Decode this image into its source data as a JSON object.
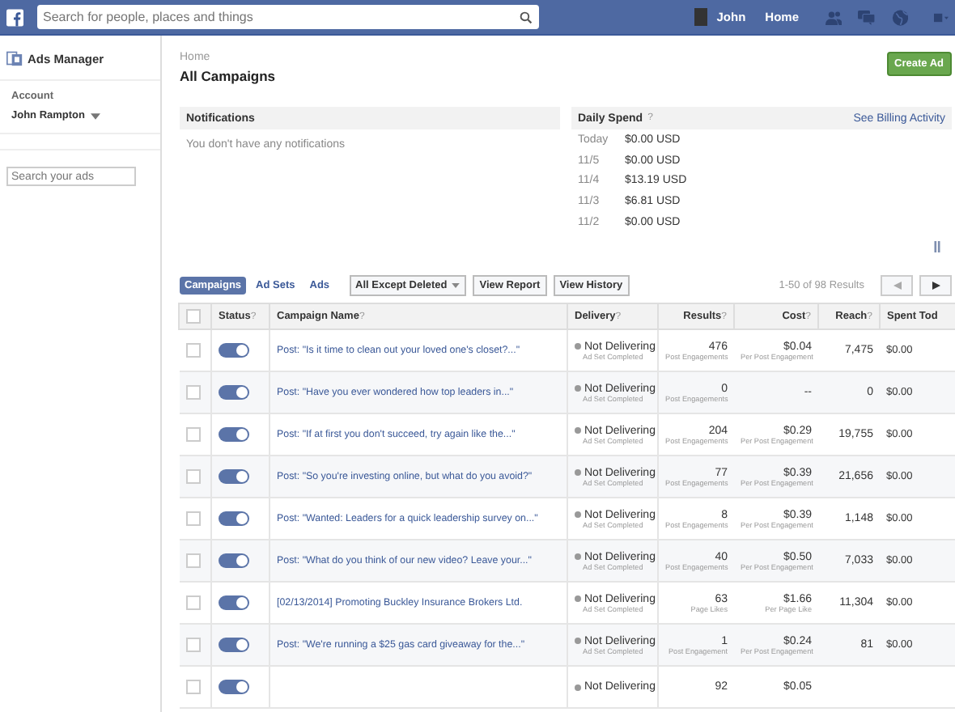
{
  "topbar": {
    "search_placeholder": "Search for people, places and things",
    "user_name": "John",
    "home_link": "Home"
  },
  "sidebar": {
    "title": "Ads Manager",
    "account_label": "Account",
    "account_name": "John Rampton",
    "search_placeholder": "Search your ads"
  },
  "breadcrumb": "Home",
  "page_title": "All Campaigns",
  "create_button": "Create Ad",
  "notifications": {
    "title": "Notifications",
    "message": "You don't have any notifications"
  },
  "daily_spend": {
    "title": "Daily Spend",
    "help": "?",
    "link": "See Billing Activity",
    "entries": [
      {
        "date": "Today",
        "amount": "$0.00 USD"
      },
      {
        "date": "11/5",
        "amount": "$0.00 USD"
      },
      {
        "date": "11/4",
        "amount": "$13.19 USD"
      },
      {
        "date": "11/3",
        "amount": "$6.81 USD"
      },
      {
        "date": "11/2",
        "amount": "$0.00 USD"
      }
    ]
  },
  "view_tabs": [
    {
      "label": "Campaigns",
      "selected": true
    },
    {
      "label": "Ad Sets",
      "selected": false
    },
    {
      "label": "Ads",
      "selected": false
    }
  ],
  "filter": "All Except Deleted",
  "buttons": [
    "View Report",
    "View History"
  ],
  "pagination": "1-50 of 98 Results",
  "table": {
    "select_all": {
      "checked": false
    },
    "columns": [
      {
        "label": "Status",
        "help": "?"
      },
      {
        "label": "Campaign Name",
        "help": "?"
      },
      {
        "label": "Delivery",
        "help": "?"
      },
      {
        "label": "Results",
        "help": "?"
      },
      {
        "label": "Cost",
        "help": "?"
      },
      {
        "label": "Reach",
        "help": "?"
      },
      {
        "label": "Spent Tod"
      }
    ],
    "rows": [
      {
        "checked": false,
        "on": true,
        "name": "Post: \"Is it time to clean out your loved one's closet?...\"",
        "delivery": "Not Delivering",
        "delivery_note": "Ad Set Completed",
        "results": "476",
        "results_unit": "Post Engagements",
        "cost": "$0.04",
        "cost_unit": "Per Post Engagement",
        "reach": "7,475",
        "spent": "$0.00"
      },
      {
        "checked": false,
        "on": true,
        "name": "Post: \"Have you ever wondered how top leaders in...\"",
        "delivery": "Not Delivering",
        "delivery_note": "Ad Set Completed",
        "results": "0",
        "results_unit": "Post Engagements",
        "cost": "--",
        "reach": "0",
        "spent": "$0.00"
      },
      {
        "checked": false,
        "on": true,
        "name": "Post: \"If at first you don't succeed, try again like the...\"",
        "delivery": "Not Delivering",
        "delivery_note": "Ad Set Completed",
        "results": "204",
        "results_unit": "Post Engagements",
        "cost": "$0.29",
        "cost_unit": "Per Post Engagement",
        "reach": "19,755",
        "spent": "$0.00"
      },
      {
        "checked": false,
        "on": true,
        "name": "Post: \"So you're investing online, but what do you avoid?\"",
        "delivery": "Not Delivering",
        "delivery_note": "Ad Set Completed",
        "results": "77",
        "results_unit": "Post Engagements",
        "cost": "$0.39",
        "cost_unit": "Per Post Engagement",
        "reach": "21,656",
        "spent": "$0.00"
      },
      {
        "checked": false,
        "on": true,
        "name": "Post: \"Wanted: Leaders for a quick leadership survey on...\"",
        "delivery": "Not Delivering",
        "delivery_note": "Ad Set Completed",
        "results": "8",
        "results_unit": "Post Engagements",
        "cost": "$0.39",
        "cost_unit": "Per Post Engagement",
        "reach": "1,148",
        "spent": "$0.00"
      },
      {
        "checked": false,
        "on": true,
        "name": "Post: \"What do you think of our new video? Leave your...\"",
        "delivery": "Not Delivering",
        "delivery_note": "Ad Set Completed",
        "results": "40",
        "results_unit": "Post Engagements",
        "cost": "$0.50",
        "cost_unit": "Per Post Engagement",
        "reach": "7,033",
        "spent": "$0.00"
      },
      {
        "checked": false,
        "on": true,
        "name": "[02/13/2014] Promoting Buckley Insurance Brokers Ltd.",
        "delivery": "Not Delivering",
        "delivery_note": "Ad Set Completed",
        "results": "63",
        "results_unit": "Page Likes",
        "cost": "$1.66",
        "cost_unit": "Per Page Like",
        "reach": "11,304",
        "spent": "$0.00"
      },
      {
        "checked": false,
        "on": true,
        "name": "Post: \"We're running a $25 gas card giveaway for the...\"",
        "delivery": "Not Delivering",
        "delivery_note": "Ad Set Completed",
        "results": "1",
        "results_unit": "Post Engagement",
        "cost": "$0.24",
        "cost_unit": "Per Post Engagement",
        "reach": "81",
        "spent": "$0.00"
      },
      {
        "checked": false,
        "on": true,
        "delivery": "Not Delivering",
        "results": "92",
        "cost": "$0.05"
      }
    ]
  }
}
